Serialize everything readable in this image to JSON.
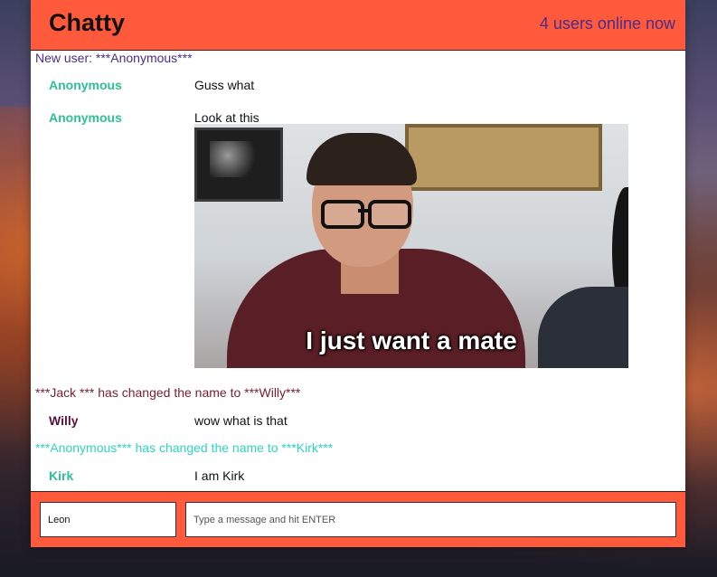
{
  "app": {
    "title": "Chatty",
    "users_online": "4 users online now"
  },
  "colors": {
    "accent": "#ff5a3c",
    "system_purple": "#4a2d86",
    "system_maroon": "#7a2030",
    "system_teal": "#2fd3c0",
    "user_teal": "#2fbf96",
    "user_purple": "#5a1240"
  },
  "messages": {
    "system_new_user": "New user: ***Anonymous***",
    "msg1": {
      "user": "Anonymous",
      "text": "Guss what"
    },
    "msg2": {
      "user": "Anonymous",
      "text": "Look at this",
      "image_caption": "I just want a mate"
    },
    "system_rename_1": "***Jack *** has changed the name to ***Willy***",
    "msg3": {
      "user": "Willy",
      "text": "wow what is that"
    },
    "system_rename_2": "***Anonymous*** has changed the name to ***Kirk***",
    "msg4": {
      "user": "Kirk",
      "text": "I am Kirk"
    }
  },
  "composer": {
    "username_value": "Leon",
    "message_placeholder": "Type a message and hit ENTER"
  }
}
